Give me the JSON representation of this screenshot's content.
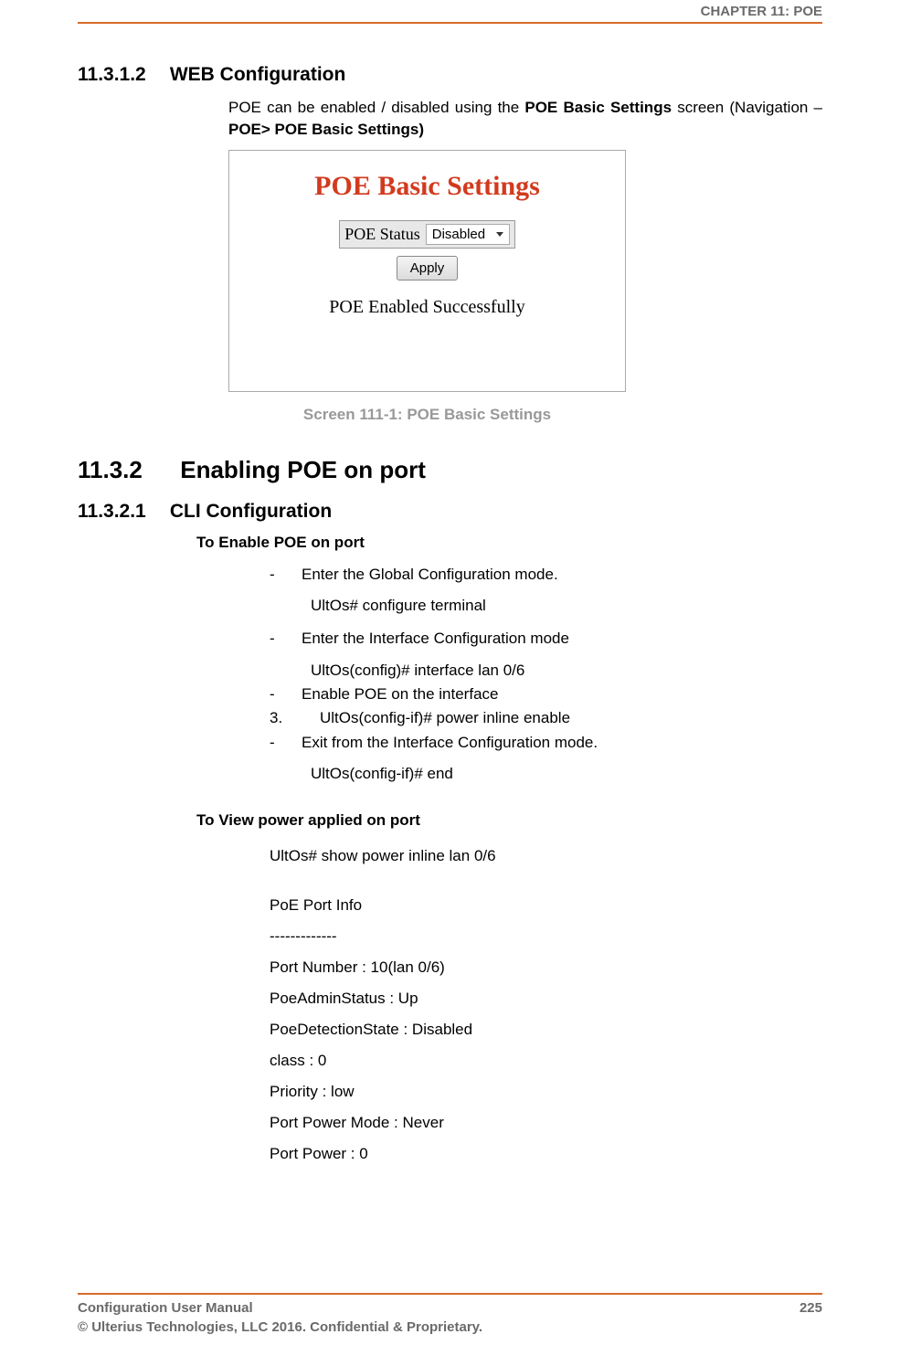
{
  "header": {
    "chapter": "CHAPTER 11: POE"
  },
  "sections": {
    "s1": {
      "num": "11.3.1.2",
      "title": "WEB Configuration",
      "para_pre": "POE can be enabled / disabled using the ",
      "para_bold1": "POE Basic Settings",
      "para_mid": " screen (Navigation – ",
      "para_bold2": "POE> POE Basic Settings)"
    },
    "figure": {
      "title": "POE Basic Settings",
      "status_label": "POE Status",
      "status_value": "Disabled",
      "apply": "Apply",
      "message": "POE Enabled Successfully",
      "caption": "Screen 111-1: POE Basic Settings"
    },
    "s2": {
      "num": "11.3.2",
      "title": "Enabling POE on port"
    },
    "s3": {
      "num": "11.3.2.1",
      "title": "CLI Configuration"
    },
    "enable": {
      "heading": "To Enable POE on port",
      "b1": "Enter the Global Configuration mode.",
      "c1": "UltOs# configure terminal",
      "b2": "Enter the Interface Configuration mode",
      "c2": "UltOs(config)# interface lan  0/6",
      "b3": "Enable POE on the interface",
      "n3": "3.",
      "c3": "UltOs(config-if)# power inline enable",
      "b4": "Exit from the Interface Configuration mode.",
      "c4": "UltOs(config-if)# end"
    },
    "view": {
      "heading": "To View power applied on port",
      "cmd": "UltOs# show power inline lan 0/6",
      "out1": "PoE Port Info",
      "out2": "-------------",
      "out3": "Port Number       : 10(lan 0/6)",
      "out4": "PoeAdminStatus    : Up",
      "out5": "PoeDetectionState : Disabled",
      "out6": "class             : 0",
      "out7": "Priority          : low",
      "out8": "Port Power Mode   : Never",
      "out9": "Port Power        : 0"
    }
  },
  "footer": {
    "line1": "Configuration User Manual",
    "line2": "© Ulterius Technologies, LLC 2016. Confidential & Proprietary.",
    "page": "225"
  }
}
